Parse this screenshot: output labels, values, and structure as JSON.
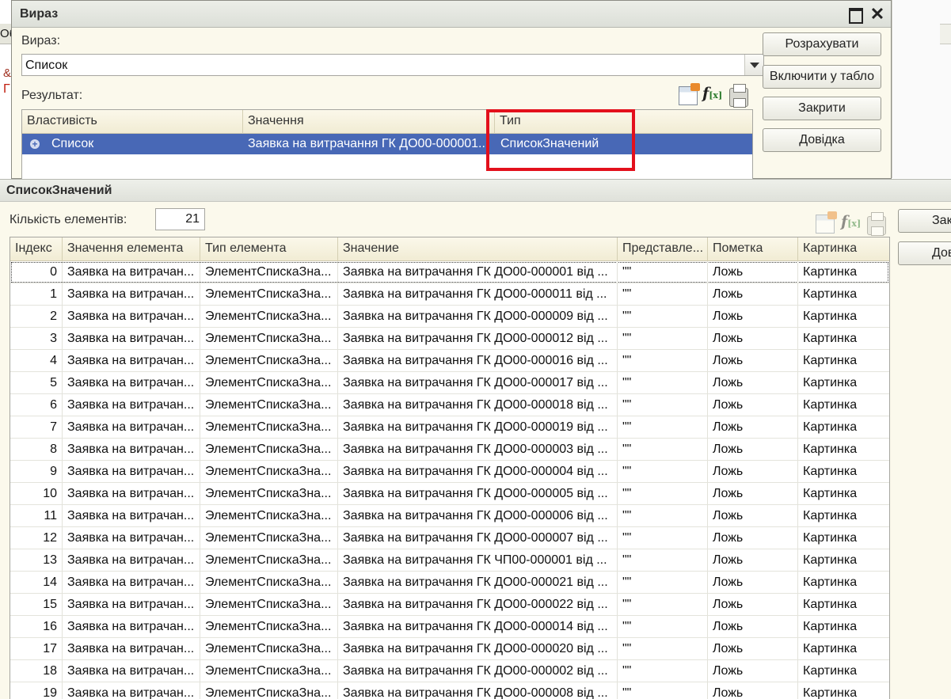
{
  "background": {
    "tab_fragment": "Об",
    "line1": "&",
    "line2": "Г"
  },
  "expr_dialog": {
    "title": "Вираз",
    "expr_label": "Вираз:",
    "expr_value": "Список",
    "result_label": "Результат:",
    "columns": [
      "Властивість",
      "Значення",
      "Тип"
    ],
    "row": {
      "property": "Список",
      "value": "Заявка на витрачання ГК ДО00-000001...",
      "type": "СписокЗначений"
    },
    "buttons": {
      "calculate": "Розрахувати",
      "include_table": "Включити у табло",
      "close": "Закрити",
      "help": "Довідка"
    },
    "icons": [
      "table-icon",
      "fx-icon",
      "printer-icon"
    ]
  },
  "list_window": {
    "title": "СписокЗначений",
    "count_label": "Кількість елементів:",
    "count_value": "21",
    "buttons": {
      "close": "Закрити",
      "help": "Довідка"
    },
    "columns": [
      "Індекс",
      "Значення елемента",
      "Тип елемента",
      "Значение",
      "Представле...",
      "Пометка",
      "Картинка"
    ],
    "rows": [
      {
        "index": "0",
        "value": "Заявка на витрачан...",
        "type": "ЭлементСпискаЗна...",
        "znach": "Заявка на витрачання ГК ДО00-000001 від ...",
        "repr": "\"\"",
        "mark": "Ложь",
        "pic": "Картинка"
      },
      {
        "index": "1",
        "value": "Заявка на витрачан...",
        "type": "ЭлементСпискаЗна...",
        "znach": "Заявка на витрачання ГК ДО00-000011 від ...",
        "repr": "\"\"",
        "mark": "Ложь",
        "pic": "Картинка"
      },
      {
        "index": "2",
        "value": "Заявка на витрачан...",
        "type": "ЭлементСпискаЗна...",
        "znach": "Заявка на витрачання ГК ДО00-000009 від ...",
        "repr": "\"\"",
        "mark": "Ложь",
        "pic": "Картинка"
      },
      {
        "index": "3",
        "value": "Заявка на витрачан...",
        "type": "ЭлементСпискаЗна...",
        "znach": "Заявка на витрачання ГК ДО00-000012 від ...",
        "repr": "\"\"",
        "mark": "Ложь",
        "pic": "Картинка"
      },
      {
        "index": "4",
        "value": "Заявка на витрачан...",
        "type": "ЭлементСпискаЗна...",
        "znach": "Заявка на витрачання ГК ДО00-000016 від ...",
        "repr": "\"\"",
        "mark": "Ложь",
        "pic": "Картинка"
      },
      {
        "index": "5",
        "value": "Заявка на витрачан...",
        "type": "ЭлементСпискаЗна...",
        "znach": "Заявка на витрачання ГК ДО00-000017 від ...",
        "repr": "\"\"",
        "mark": "Ложь",
        "pic": "Картинка"
      },
      {
        "index": "6",
        "value": "Заявка на витрачан...",
        "type": "ЭлементСпискаЗна...",
        "znach": "Заявка на витрачання ГК ДО00-000018 від ...",
        "repr": "\"\"",
        "mark": "Ложь",
        "pic": "Картинка"
      },
      {
        "index": "7",
        "value": "Заявка на витрачан...",
        "type": "ЭлементСпискаЗна...",
        "znach": "Заявка на витрачання ГК ДО00-000019 від ...",
        "repr": "\"\"",
        "mark": "Ложь",
        "pic": "Картинка"
      },
      {
        "index": "8",
        "value": "Заявка на витрачан...",
        "type": "ЭлементСпискаЗна...",
        "znach": "Заявка на витрачання ГК ДО00-000003 від ...",
        "repr": "\"\"",
        "mark": "Ложь",
        "pic": "Картинка"
      },
      {
        "index": "9",
        "value": "Заявка на витрачан...",
        "type": "ЭлементСпискаЗна...",
        "znach": "Заявка на витрачання ГК ДО00-000004 від ...",
        "repr": "\"\"",
        "mark": "Ложь",
        "pic": "Картинка"
      },
      {
        "index": "10",
        "value": "Заявка на витрачан...",
        "type": "ЭлементСпискаЗна...",
        "znach": "Заявка на витрачання ГК ДО00-000005 від ...",
        "repr": "\"\"",
        "mark": "Ложь",
        "pic": "Картинка"
      },
      {
        "index": "11",
        "value": "Заявка на витрачан...",
        "type": "ЭлементСпискаЗна...",
        "znach": "Заявка на витрачання ГК ДО00-000006 від ...",
        "repr": "\"\"",
        "mark": "Ложь",
        "pic": "Картинка"
      },
      {
        "index": "12",
        "value": "Заявка на витрачан...",
        "type": "ЭлементСпискаЗна...",
        "znach": "Заявка на витрачання ГК ДО00-000007 від ...",
        "repr": "\"\"",
        "mark": "Ложь",
        "pic": "Картинка"
      },
      {
        "index": "13",
        "value": "Заявка на витрачан...",
        "type": "ЭлементСпискаЗна...",
        "znach": "Заявка на витрачання ГК ЧП00-000001 від ...",
        "repr": "\"\"",
        "mark": "Ложь",
        "pic": "Картинка"
      },
      {
        "index": "14",
        "value": "Заявка на витрачан...",
        "type": "ЭлементСпискаЗна...",
        "znach": "Заявка на витрачання ГК ДО00-000021 від ...",
        "repr": "\"\"",
        "mark": "Ложь",
        "pic": "Картинка"
      },
      {
        "index": "15",
        "value": "Заявка на витрачан...",
        "type": "ЭлементСпискаЗна...",
        "znach": "Заявка на витрачання ГК ДО00-000022 від ...",
        "repr": "\"\"",
        "mark": "Ложь",
        "pic": "Картинка"
      },
      {
        "index": "16",
        "value": "Заявка на витрачан...",
        "type": "ЭлементСпискаЗна...",
        "znach": "Заявка на витрачання ГК ДО00-000014 від ...",
        "repr": "\"\"",
        "mark": "Ложь",
        "pic": "Картинка"
      },
      {
        "index": "17",
        "value": "Заявка на витрачан...",
        "type": "ЭлементСпискаЗна...",
        "znach": "Заявка на витрачання ГК ДО00-000020 від ...",
        "repr": "\"\"",
        "mark": "Ложь",
        "pic": "Картинка"
      },
      {
        "index": "18",
        "value": "Заявка на витрачан...",
        "type": "ЭлементСпискаЗна...",
        "znach": "Заявка на витрачання ГК ДО00-000002 від ...",
        "repr": "\"\"",
        "mark": "Ложь",
        "pic": "Картинка"
      },
      {
        "index": "19",
        "value": "Заявка на витрачан...",
        "type": "ЭлементСпискаЗна...",
        "znach": "Заявка на витрачання ГК ДО00-000008 від ...",
        "repr": "\"\"",
        "mark": "Ложь",
        "pic": "Картинка"
      }
    ]
  },
  "colors": {
    "selection": "#4868b6",
    "highlight_box": "#e3101c",
    "panel": "#fbf9ec"
  }
}
